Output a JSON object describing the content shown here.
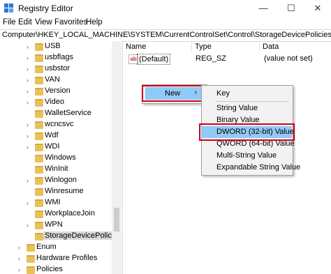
{
  "window": {
    "title": "Registry Editor",
    "minimize_glyph": "—",
    "maximize_glyph": "☐",
    "close_glyph": "✕"
  },
  "menu": [
    "File",
    "Edit",
    "View",
    "Favorites",
    "Help"
  ],
  "address": "Computer\\HKEY_LOCAL_MACHINE\\SYSTEM\\CurrentControlSet\\Control\\StorageDevicePolicies",
  "tree": [
    {
      "label": "USB",
      "expandable": true
    },
    {
      "label": "usbflags",
      "expandable": true
    },
    {
      "label": "usbstor",
      "expandable": true
    },
    {
      "label": "VAN",
      "expandable": true
    },
    {
      "label": "Version",
      "expandable": true
    },
    {
      "label": "Video",
      "expandable": true
    },
    {
      "label": "WalletService",
      "expandable": false
    },
    {
      "label": "wcncsvc",
      "expandable": true
    },
    {
      "label": "Wdf",
      "expandable": true
    },
    {
      "label": "WDI",
      "expandable": true
    },
    {
      "label": "Windows",
      "expandable": false
    },
    {
      "label": "WinInit",
      "expandable": false
    },
    {
      "label": "Winlogon",
      "expandable": true
    },
    {
      "label": "Winresume",
      "expandable": false
    },
    {
      "label": "WMI",
      "expandable": true
    },
    {
      "label": "WorkplaceJoin",
      "expandable": false
    },
    {
      "label": "WPN",
      "expandable": true
    },
    {
      "label": "StorageDevicePolicies",
      "expandable": false,
      "selected": true
    },
    {
      "label": "Enum",
      "expandable": true
    },
    {
      "label": "Hardware Profiles",
      "expandable": true
    },
    {
      "label": "Policies",
      "expandable": true
    }
  ],
  "columns": {
    "name": "Name",
    "type": "Type",
    "data": "Data"
  },
  "values": [
    {
      "icon": "ab",
      "name": "(Default)",
      "type": "REG_SZ",
      "data": "(value not set)"
    }
  ],
  "context_menu": {
    "new_label": "New",
    "new_arrow": "›",
    "submenu": [
      "Key",
      "String Value",
      "Binary Value",
      "DWORD (32-bit) Value",
      "QWORD (64-bit) Value",
      "Multi-String Value",
      "Expandable String Value"
    ],
    "highlighted": "DWORD (32-bit) Value"
  },
  "colors": {
    "highlight": "#91c9f7",
    "annotation_box": "#d0021b",
    "folder": "#e8c15a"
  }
}
